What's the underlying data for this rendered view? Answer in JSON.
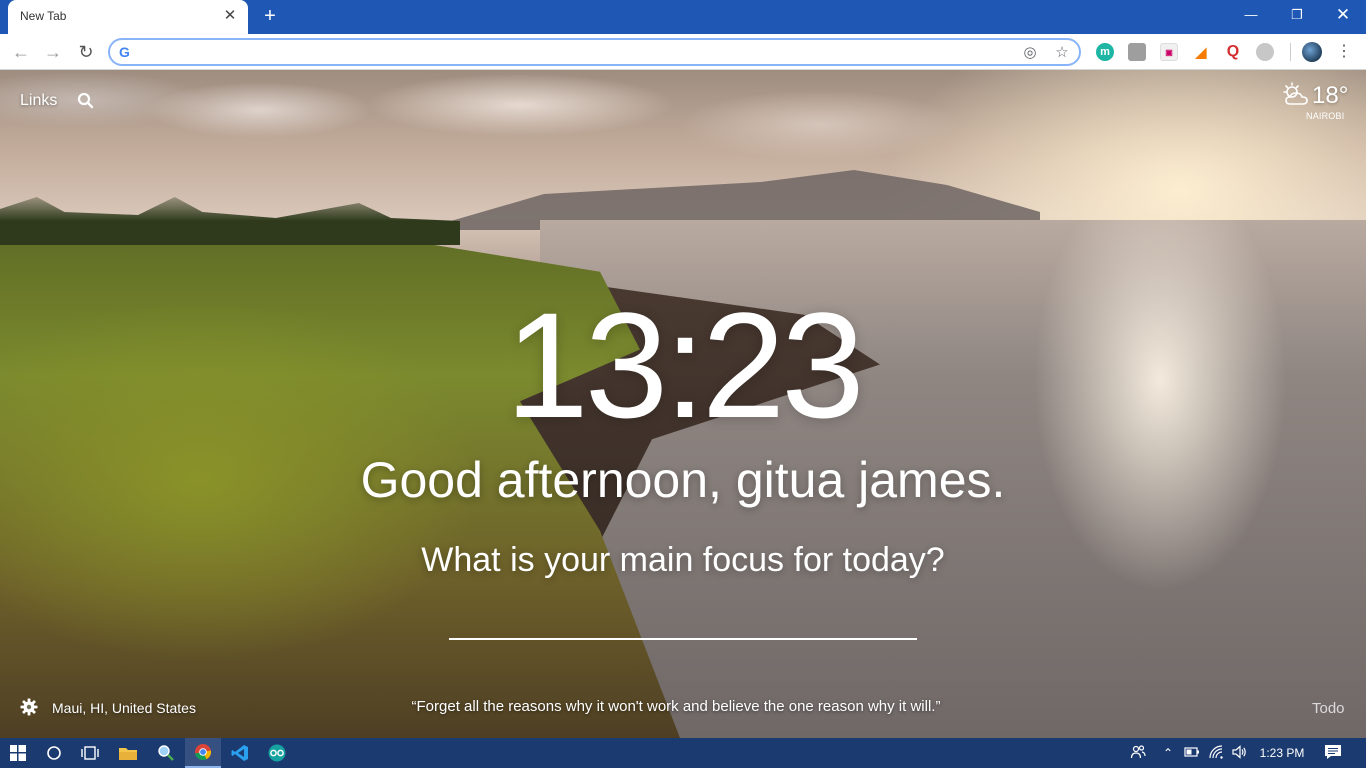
{
  "browser": {
    "tab_title": "New Tab",
    "tab_close": "✕",
    "new_tab": "+",
    "omnibox_value": "",
    "omnibox_placeholder": "",
    "extensions": [
      "momentum-icon",
      "extension-icon",
      "extension-icon",
      "extension-icon",
      "quora-icon",
      "extension-icon"
    ],
    "ext_m_label": "m",
    "ext_q_label": "Q"
  },
  "momentum": {
    "links_label": "Links",
    "temperature": "18°",
    "city": "NAIROBI",
    "time": "13:23",
    "greeting": "Good afternoon, gitua james.",
    "focus_question": "What is your main focus for today?",
    "focus_value": "",
    "photo_location": "Maui, HI, United States",
    "quote": "“Forget all the reasons why it won't work and believe the one reason why it will.”",
    "todo_label": "Todo"
  },
  "taskbar": {
    "clock": "1:23 PM",
    "pinned": [
      "windows-start-icon",
      "search-icon",
      "task-view-icon",
      "file-explorer-icon",
      "magnifier-icon",
      "chrome-icon",
      "vscode-icon",
      "arduino-icon"
    ]
  },
  "colors": {
    "titlebar": "#1f57b4",
    "taskbar": "#1b3a70",
    "omnibox_border": "#8ab4f8"
  }
}
